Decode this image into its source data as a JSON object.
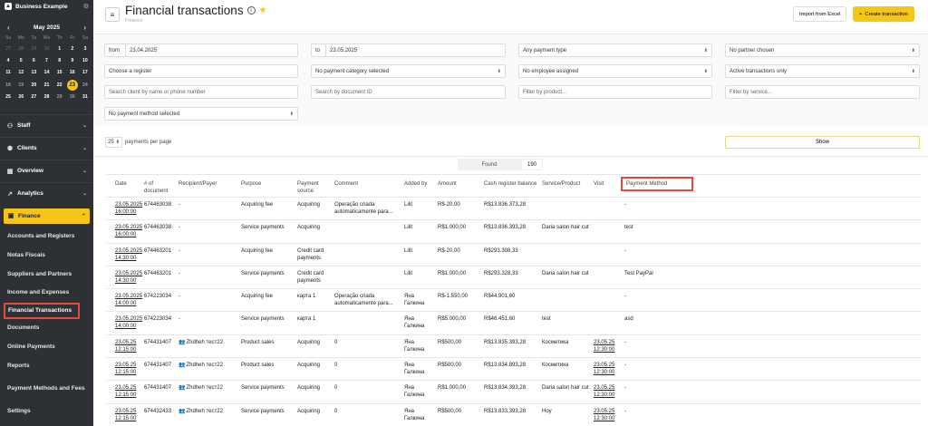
{
  "business": {
    "name": "Business Example"
  },
  "calendar": {
    "month": "May 2025",
    "weekdays": [
      "Su",
      "Mo",
      "Tu",
      "We",
      "Th",
      "Fr",
      "Sa"
    ],
    "days": [
      {
        "d": "27",
        "t": "dim"
      },
      {
        "d": "28",
        "t": "dim"
      },
      {
        "d": "29",
        "t": "dim"
      },
      {
        "d": "30",
        "t": "dim"
      },
      {
        "d": "1",
        "t": ""
      },
      {
        "d": "2",
        "t": ""
      },
      {
        "d": "3",
        "t": ""
      },
      {
        "d": "4",
        "t": ""
      },
      {
        "d": "5",
        "t": ""
      },
      {
        "d": "6",
        "t": ""
      },
      {
        "d": "7",
        "t": ""
      },
      {
        "d": "8",
        "t": ""
      },
      {
        "d": "9",
        "t": ""
      },
      {
        "d": "10",
        "t": ""
      },
      {
        "d": "11",
        "t": ""
      },
      {
        "d": "12",
        "t": ""
      },
      {
        "d": "13",
        "t": ""
      },
      {
        "d": "14",
        "t": ""
      },
      {
        "d": "15",
        "t": ""
      },
      {
        "d": "16",
        "t": ""
      },
      {
        "d": "17",
        "t": ""
      },
      {
        "d": "18",
        "t": "wk"
      },
      {
        "d": "19",
        "t": "wk"
      },
      {
        "d": "20",
        "t": ""
      },
      {
        "d": "21",
        "t": ""
      },
      {
        "d": "22",
        "t": ""
      },
      {
        "d": "23",
        "t": "today"
      },
      {
        "d": "24",
        "t": "wk"
      },
      {
        "d": "25",
        "t": ""
      },
      {
        "d": "26",
        "t": ""
      },
      {
        "d": "27",
        "t": ""
      },
      {
        "d": "28",
        "t": ""
      },
      {
        "d": "29",
        "t": "wk"
      },
      {
        "d": "30",
        "t": "wk"
      },
      {
        "d": "31",
        "t": ""
      }
    ]
  },
  "nav": {
    "staff": "Staff",
    "clients": "Clients",
    "overview": "Overview",
    "analytics": "Analytics",
    "finance": "Finance",
    "sub": [
      "Accounts and Registers",
      "Notas Fiscais",
      "Suppliers and Partners",
      "Income and Expenses",
      "Financial Transactions",
      "Documents",
      "Online Payments",
      "Reports",
      "Payment Methods and Fees",
      "Settings"
    ]
  },
  "header": {
    "title": "Financial transactions",
    "breadcrumb": "Finance",
    "import_label": "Import from Excel",
    "create_label": "Create transaction"
  },
  "filters": {
    "from_label": "from",
    "from_value": "23.04.2025",
    "to_label": "to",
    "to_value": "23.05.2025",
    "payment_type": "Any payment type",
    "partner": "No partner chosen",
    "register": "Choose a register",
    "category": "No payment category selected",
    "employee": "No employee assigned",
    "active": "Active transactions only",
    "search_client": "Search client by name or phone number",
    "search_doc": "Search by document ID",
    "product": "Filter by product...",
    "service": "Filter by service...",
    "payment_method": "No payment method selected",
    "per_page_value": "25",
    "per_page_label": "payments per page",
    "show_label": "Show",
    "found_label": "Found",
    "found_count": "190"
  },
  "table": {
    "headers": [
      "Date",
      "# of document",
      "Recipient/Payer",
      "Purpose",
      "Payment source",
      "Comment",
      "Added by",
      "Amount",
      "Cash register balance",
      "Service/Product",
      "Visit",
      "Payment Method"
    ],
    "rows": [
      {
        "date": "23.05.2025",
        "time": "16:00:00",
        "doc": "674463038",
        "payer": "-",
        "purpose": "Acquiring fee",
        "source": "Acquiring",
        "comment": "Operação criada automaticamente para...",
        "added": "Lilit",
        "amount": "R$-20,00",
        "balance": "R$13.836.373,28",
        "service": "",
        "visit": "",
        "visit_time": "",
        "method": "-",
        "user_icon": false
      },
      {
        "date": "23.05.2025",
        "time": "16:00:00",
        "doc": "674463038",
        "payer": "-",
        "purpose": "Service payments",
        "source": "Acquiring",
        "comment": "",
        "added": "Lilit",
        "amount": "R$1.000,00",
        "balance": "R$13.836.393,28",
        "service": "Daria salon hair cut",
        "visit": "",
        "visit_time": "",
        "method": "test",
        "user_icon": false
      },
      {
        "date": "23.05.2025",
        "time": "14:30:00",
        "doc": "674463201",
        "payer": "-",
        "purpose": "Acquiring fee",
        "source": "Credit card payments",
        "comment": "",
        "added": "Lilit",
        "amount": "R$-20,00",
        "balance": "R$293.308,33",
        "service": "",
        "visit": "",
        "visit_time": "",
        "method": "-",
        "user_icon": false
      },
      {
        "date": "23.05.2025",
        "time": "14:30:00",
        "doc": "674463201",
        "payer": "-",
        "purpose": "Service payments",
        "source": "Credit card payments",
        "comment": "",
        "added": "Lilit",
        "amount": "R$1.000,00",
        "balance": "R$293.328,33",
        "service": "Daria salon hair cut",
        "visit": "",
        "visit_time": "",
        "method": "Test PayPal",
        "user_icon": false
      },
      {
        "date": "23.05.2025",
        "time": "14:00:00",
        "doc": "674223034",
        "payer": "-",
        "purpose": "Acquiring fee",
        "source": "карта 1",
        "comment": "Operação criada automaticamente para...",
        "added": "Яна Галкина",
        "amount": "R$-1.550,00",
        "balance": "R$44.901,60",
        "service": "",
        "visit": "",
        "visit_time": "",
        "method": "-",
        "user_icon": false
      },
      {
        "date": "23.05.2025",
        "time": "14:00:00",
        "doc": "674223034",
        "payer": "-",
        "purpose": "Service payments",
        "source": "карта 1",
        "comment": "",
        "added": "Яна Галкина",
        "amount": "R$5.000,00",
        "balance": "R$46.451,60",
        "service": "test",
        "visit": "",
        "visit_time": "",
        "method": "asd",
        "user_icon": false
      },
      {
        "date": "23.05.25",
        "time": "12:15:00",
        "doc": "674431407",
        "payer": "Zhdheh тест22",
        "purpose": "Product sales",
        "source": "Acquiring",
        "comment": "0",
        "added": "Яна Галкина",
        "amount": "R$500,00",
        "balance": "R$13.835.393,28",
        "service": "Косметика",
        "visit": "23.05.25",
        "visit_time": "12:30:00",
        "method": "-",
        "user_icon": true
      },
      {
        "date": "23.05.25",
        "time": "12:15:00",
        "doc": "674431407",
        "payer": "Zhdheh тест22",
        "purpose": "Product sales",
        "source": "Acquiring",
        "comment": "0",
        "added": "Яна Галкина",
        "amount": "R$500,00",
        "balance": "R$13.834.893,28",
        "service": "Косметика",
        "visit": "23.05.25",
        "visit_time": "12:30:00",
        "method": "-",
        "user_icon": true
      },
      {
        "date": "23.05.25",
        "time": "12:15:00",
        "doc": "674431407",
        "payer": "Zhdheh тест22",
        "purpose": "Service payments",
        "source": "Acquiring",
        "comment": "0",
        "added": "Яна Галкина",
        "amount": "R$1.000,00",
        "balance": "R$13.834.393,28",
        "service": "Daria salon hair cut",
        "visit": "23.05.25",
        "visit_time": "12:30:00",
        "method": "-",
        "user_icon": true
      },
      {
        "date": "23.05.25",
        "time": "12:15:00",
        "doc": "674432433",
        "payer": "Zhdheh тест22",
        "purpose": "Service payments",
        "source": "Acquiring",
        "comment": "0",
        "added": "Яна Галкина",
        "amount": "R$500,00",
        "balance": "R$13.833.393,28",
        "service": "Hoy",
        "visit": "23.05.25",
        "visit_time": "12:30:00",
        "method": "-",
        "user_icon": true
      }
    ]
  }
}
